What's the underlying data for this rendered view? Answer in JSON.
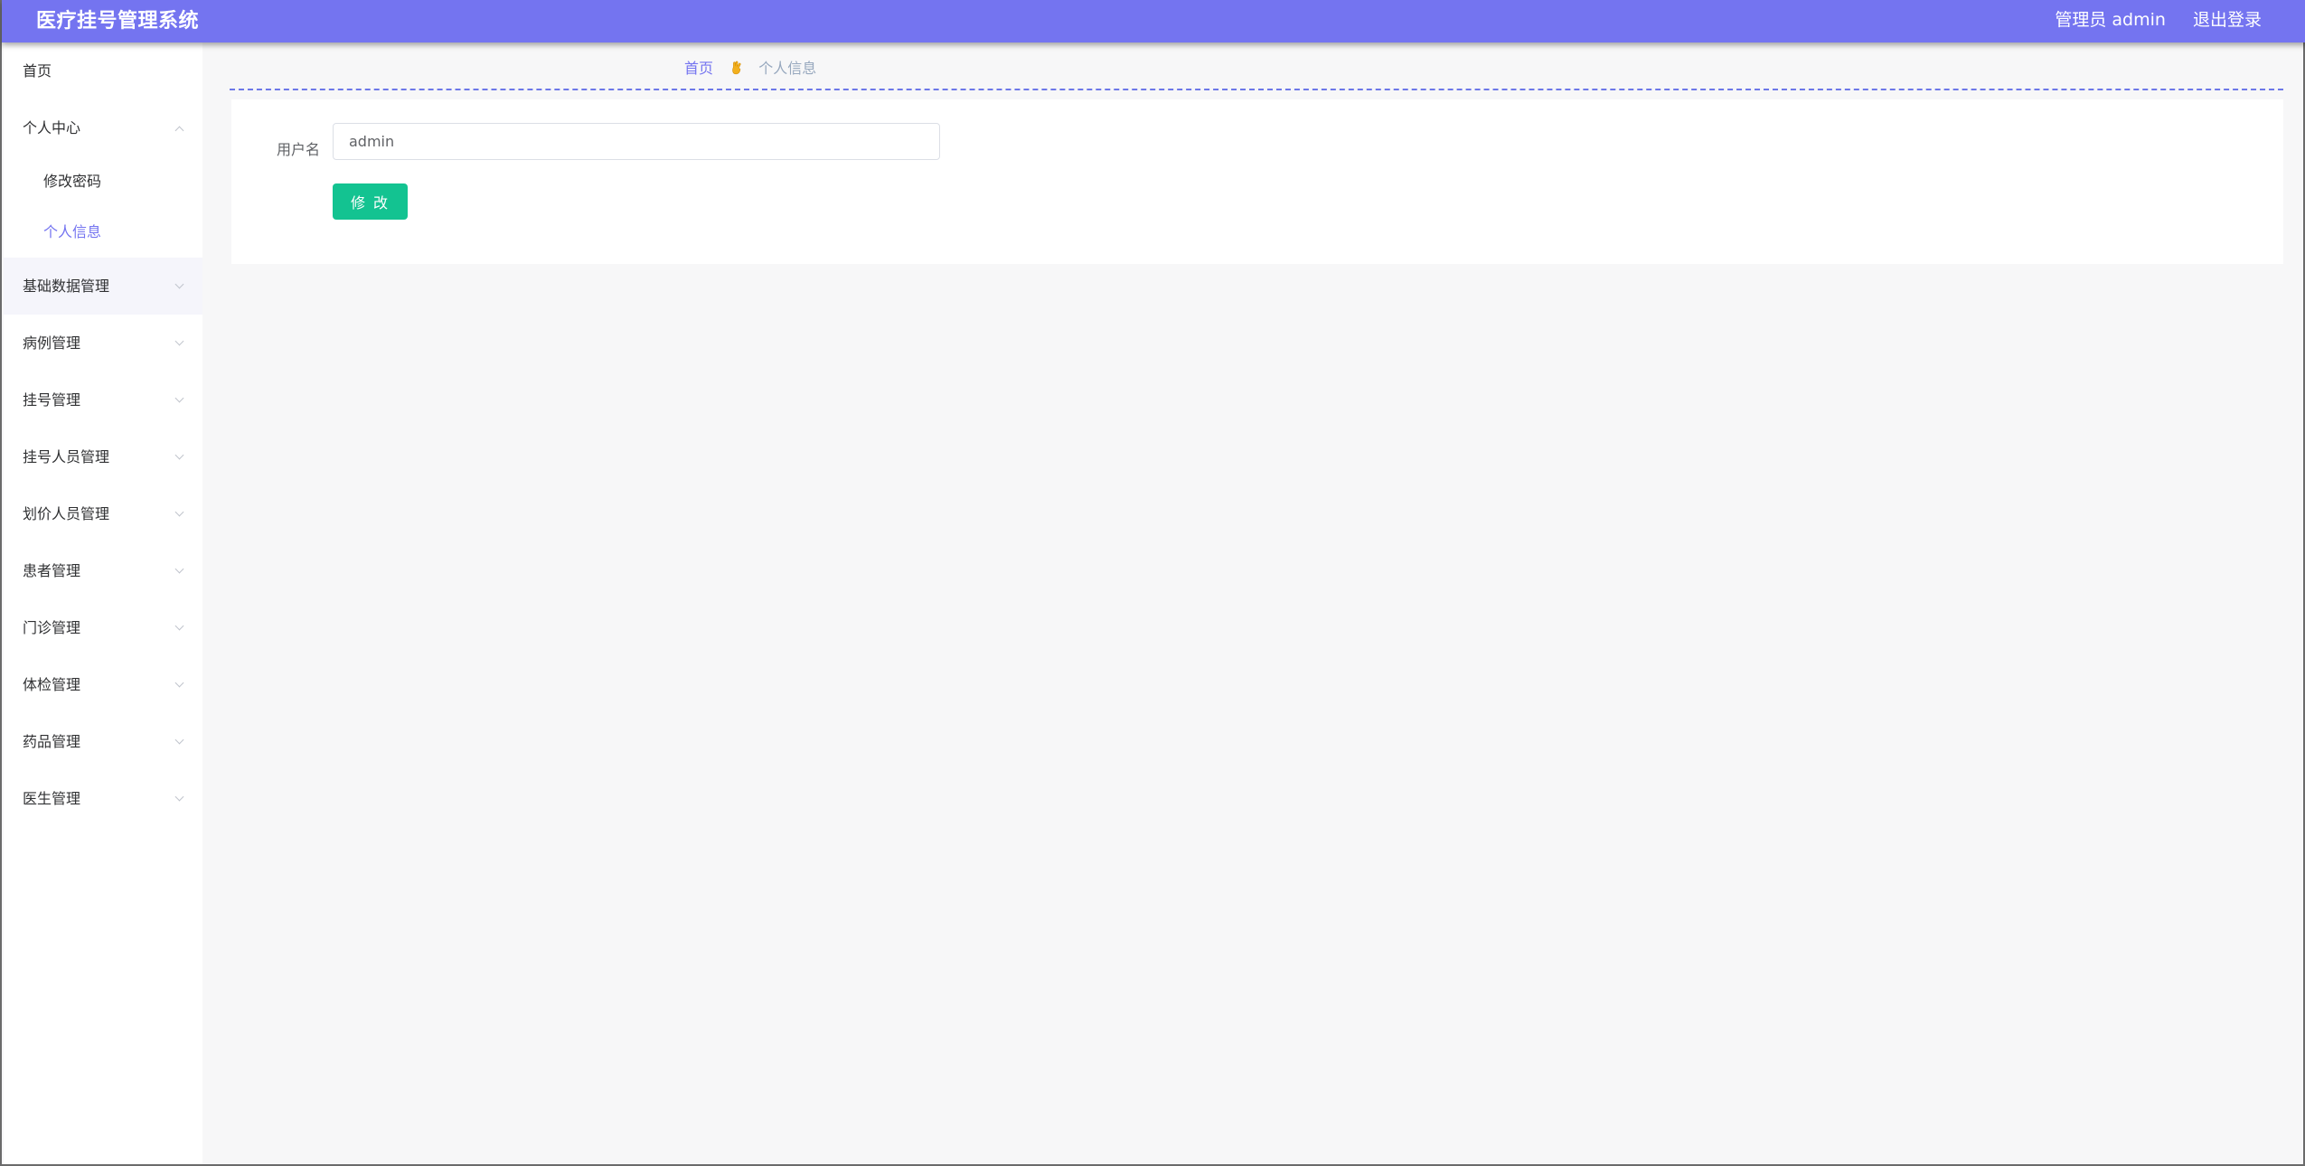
{
  "header": {
    "app_title": "医疗挂号管理系统",
    "user_label": "管理员 admin",
    "logout_label": "退出登录"
  },
  "sidebar": {
    "items": [
      {
        "label": "首页"
      },
      {
        "label": "个人中心",
        "children": [
          {
            "label": "修改密码"
          },
          {
            "label": "个人信息"
          }
        ]
      },
      {
        "label": "基础数据管理"
      },
      {
        "label": "病例管理"
      },
      {
        "label": "挂号管理"
      },
      {
        "label": "挂号人员管理"
      },
      {
        "label": "划价人员管理"
      },
      {
        "label": "患者管理"
      },
      {
        "label": "门诊管理"
      },
      {
        "label": "体检管理"
      },
      {
        "label": "药品管理"
      },
      {
        "label": "医生管理"
      }
    ]
  },
  "breadcrumb": {
    "home": "首页",
    "current": "个人信息",
    "separator_icon": "hand-icon"
  },
  "form": {
    "username_label": "用户名",
    "username_value": "admin",
    "submit_label": "修 改"
  },
  "colors": {
    "primary": "#7474f0",
    "button": "#13c391"
  }
}
